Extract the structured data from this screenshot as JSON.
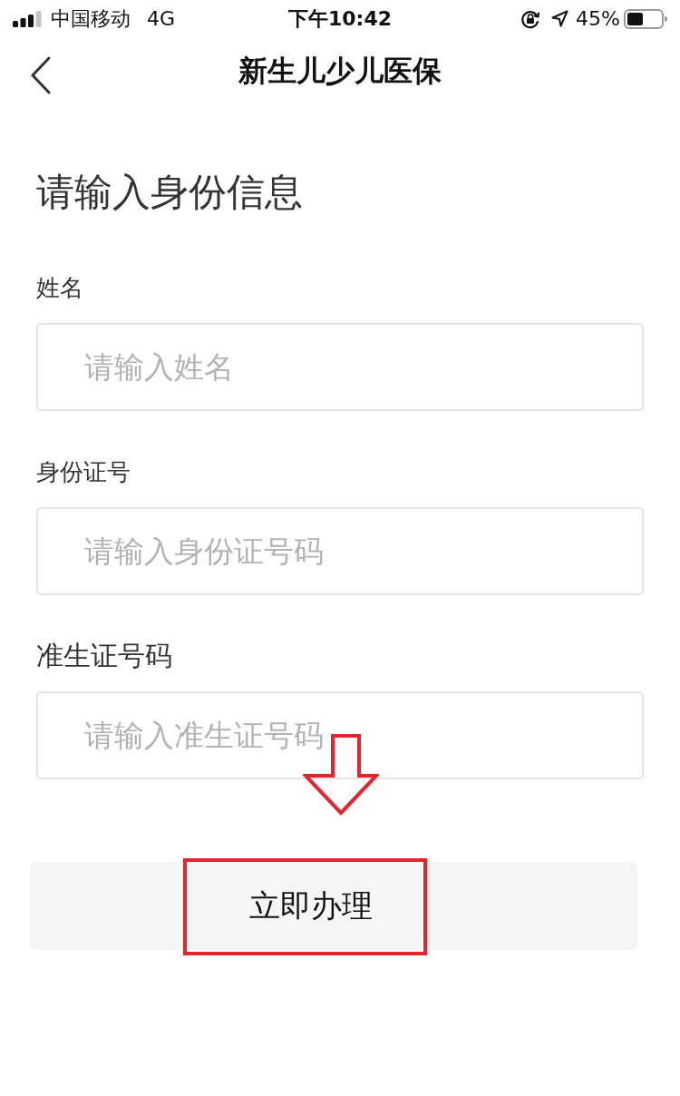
{
  "status_bar": {
    "carrier": "中国移动",
    "network": "4G",
    "time": "下午10:42",
    "battery": "45%"
  },
  "nav": {
    "title": "新生儿少儿医保"
  },
  "heading": "请输入身份信息",
  "fields": [
    {
      "label": "姓名",
      "placeholder": "请输入姓名"
    },
    {
      "label": "身份证号",
      "placeholder": "请输入身份证号码"
    },
    {
      "label": "准生证号码",
      "placeholder": "请输入准生证号码"
    }
  ],
  "submit_button": {
    "label": "立即办理"
  },
  "annotations": [
    {
      "kind": "arrow"
    },
    {
      "kind": "highlight_box"
    }
  ]
}
